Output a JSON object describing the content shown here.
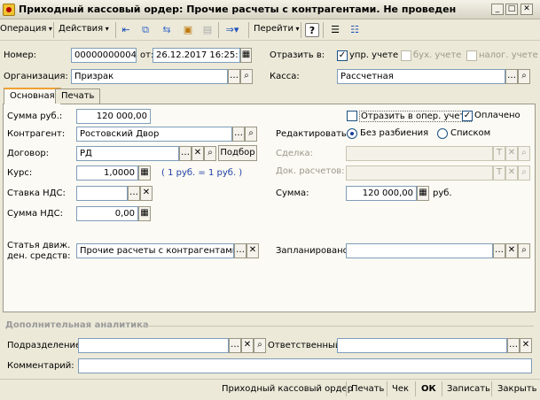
{
  "window": {
    "title": "Приходный кассовый ордер: Прочие расчеты с контрагентами. Не проведен"
  },
  "toolbar": {
    "operation": "Операция",
    "actions": "Действия",
    "goto": "Перейти",
    "help": "?"
  },
  "header": {
    "number_label": "Номер:",
    "number_value": "00000000004",
    "from_label": "от:",
    "date_value": "26.12.2017 16:25:17",
    "reflect_label": "Отразить в:",
    "upr": "упр. учете",
    "buh": "бух. учете",
    "nalog": "налог. учете",
    "org_label": "Организация:",
    "org_value": "Призрак",
    "kassa_label": "Касса:",
    "kassa_value": "Рассчетная"
  },
  "tabs": [
    "Основная",
    "Печать"
  ],
  "main": {
    "sum_label": "Сумма руб.:",
    "sum_value": "120 000,00",
    "oper_label": "Отразить в опер. учете",
    "paid_label": "Оплачено",
    "contr_label": "Контрагент:",
    "contr_value": "Ростовский Двор",
    "edit_label": "Редактировать:",
    "radio1": "Без разбиения",
    "radio2": "Списком",
    "dogovor_label": "Договор:",
    "dogovor_value": "РД",
    "podbor": "Подбор",
    "sdelka_label": "Сделка:",
    "kurs_label": "Курс:",
    "kurs_value": "1,0000",
    "kurs_note": "( 1 руб. = 1 руб. )",
    "dok_label": "Док. расчетов:",
    "nds_rate_label": "Ставка НДС:",
    "summa_label": "Сумма:",
    "summa_value": "120 000,00",
    "summa_unit": "руб.",
    "nds_sum_label": "Сумма НДС:",
    "nds_sum_value": "0,00",
    "statya_label_1": "Статья движ.",
    "statya_label_2": "ден. средств:",
    "statya_value": "Прочие расчеты с контрагентами",
    "plan_label": "Запланировано:"
  },
  "extra": {
    "section_title": "Дополнительная аналитика",
    "div_label": "Подразделение:",
    "resp_label": "Ответственный:",
    "comment_label": "Комментарий:"
  },
  "footer": {
    "order": "Приходный кассовый ордер",
    "print": "Печать",
    "check": "Чек",
    "ok": "ОК",
    "save": "Записать",
    "close": "Закрыть"
  }
}
